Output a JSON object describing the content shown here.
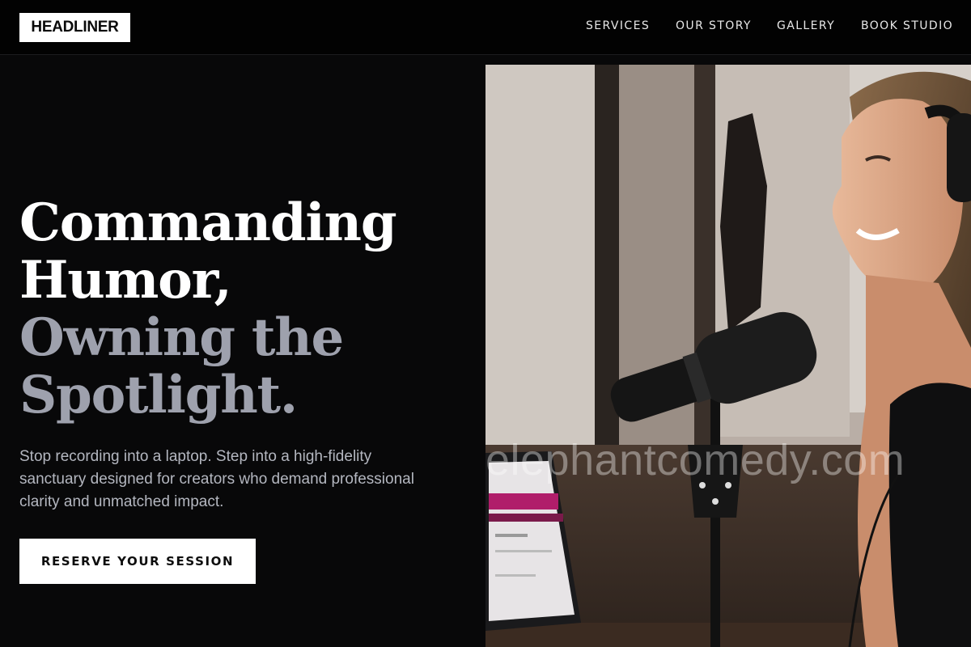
{
  "brand": {
    "logo": "HEADLINER"
  },
  "nav": {
    "items": [
      {
        "label": "SERVICES"
      },
      {
        "label": "OUR STORY"
      },
      {
        "label": "GALLERY"
      },
      {
        "label": "BOOK STUDIO"
      }
    ]
  },
  "hero": {
    "title_lines": [
      "Commanding",
      "Humor,"
    ],
    "title_accent_lines": [
      "Owning the",
      "Spotlight."
    ],
    "description": "Stop recording into a laptop. Step into a high-fidelity sanctuary designed for creators who demand professional clarity and unmatched impact.",
    "cta_label": "RESERVE YOUR SESSION"
  },
  "photo": {
    "watermark": "elephantcomedy.com",
    "icon": "podcast-woman-microphone-photo"
  },
  "colors": {
    "background": "#080809",
    "header": "#020202",
    "accent_gray": "#9ea1ad",
    "text_muted": "#b4b7c0",
    "button_bg": "#ffffff"
  }
}
